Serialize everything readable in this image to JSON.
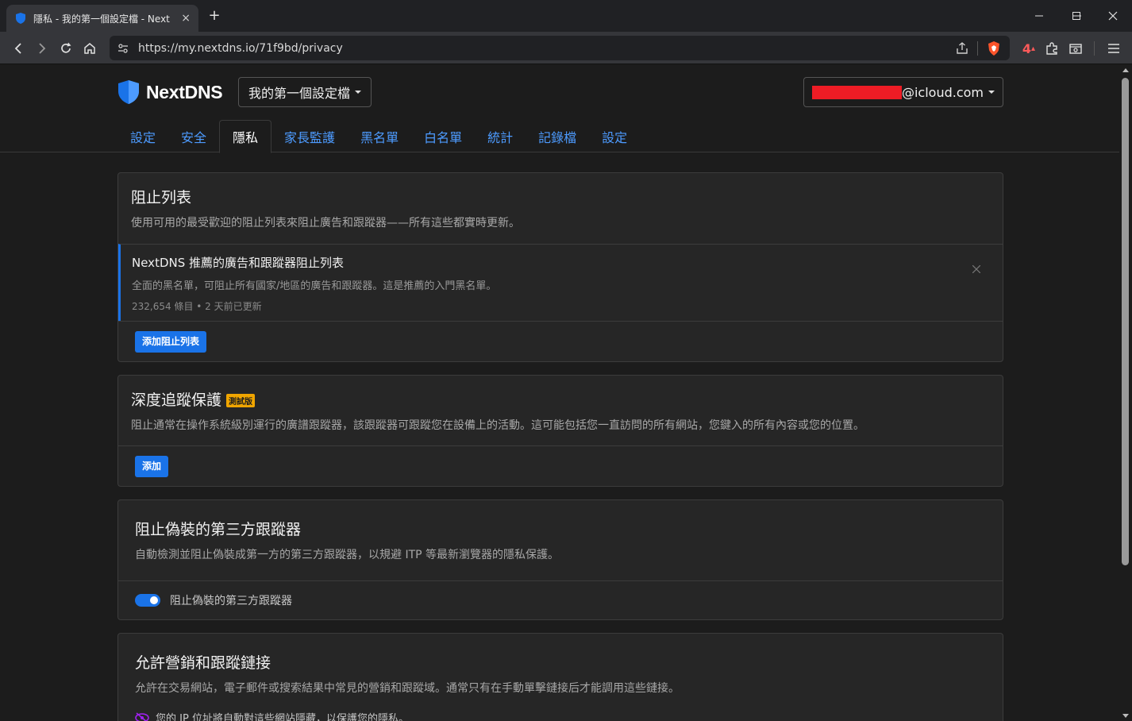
{
  "browser": {
    "tab_title": "隱私 - 我的第一個設定檔 - NextDNS",
    "tab_close": "×",
    "new_tab": "+",
    "url": "https://my.nextdns.io/71f9bd/privacy",
    "shields_badge": "4"
  },
  "header": {
    "brand": "NextDNS",
    "profile": "我的第一個設定檔",
    "account_suffix": "@icloud.com"
  },
  "nav": {
    "items": [
      "設定",
      "安全",
      "隱私",
      "家長監護",
      "黑名單",
      "白名單",
      "統計",
      "記錄檔",
      "設定"
    ]
  },
  "blocklists": {
    "title": "阻止列表",
    "description": "使用可用的最受歡迎的阻止列表來阻止廣告和跟蹤器——所有這些都實時更新。",
    "item_name": "NextDNS 推薦的廣告和跟蹤器阻止列表",
    "item_description": "全面的黑名單，可阻止所有國家/地區的廣告和跟蹤器。這是推薦的入門黑名單。",
    "item_meta": "232,654 條目 • 2 天前已更新",
    "add_button": "添加阻止列表"
  },
  "native_tracking": {
    "title": "深度追蹤保護",
    "beta": "測試版",
    "description": "阻止通常在操作系統級別運行的廣譜跟蹤器，該跟蹤器可跟蹤您在設備上的活動。這可能包括您一直訪問的所有網站，您鍵入的所有內容或您的位置。",
    "add_button": "添加"
  },
  "disguised": {
    "title": "阻止偽裝的第三方跟蹤器",
    "description": "自動檢測並阻止偽裝成第一方的第三方跟蹤器，以規避 ITP 等最新瀏覽器的隱私保護。",
    "toggle_label": "阻止偽裝的第三方跟蹤器",
    "toggle_on": true
  },
  "affiliate": {
    "title": "允許營銷和跟蹤鏈接",
    "description": "允許在交易網站，電子郵件或搜索結果中常見的營銷和跟蹤域。通常只有在手動單擊鏈接后才能調用這些鏈接。",
    "note": "您的 IP 位址將自動對這些網站隱藏，以保護您的隱私。"
  },
  "colors": {
    "accent": "#1a73e8",
    "link": "#4d9bff",
    "beta": "#f0a500",
    "redaction": "#ee1c25",
    "note_icon": "#a020f0"
  }
}
